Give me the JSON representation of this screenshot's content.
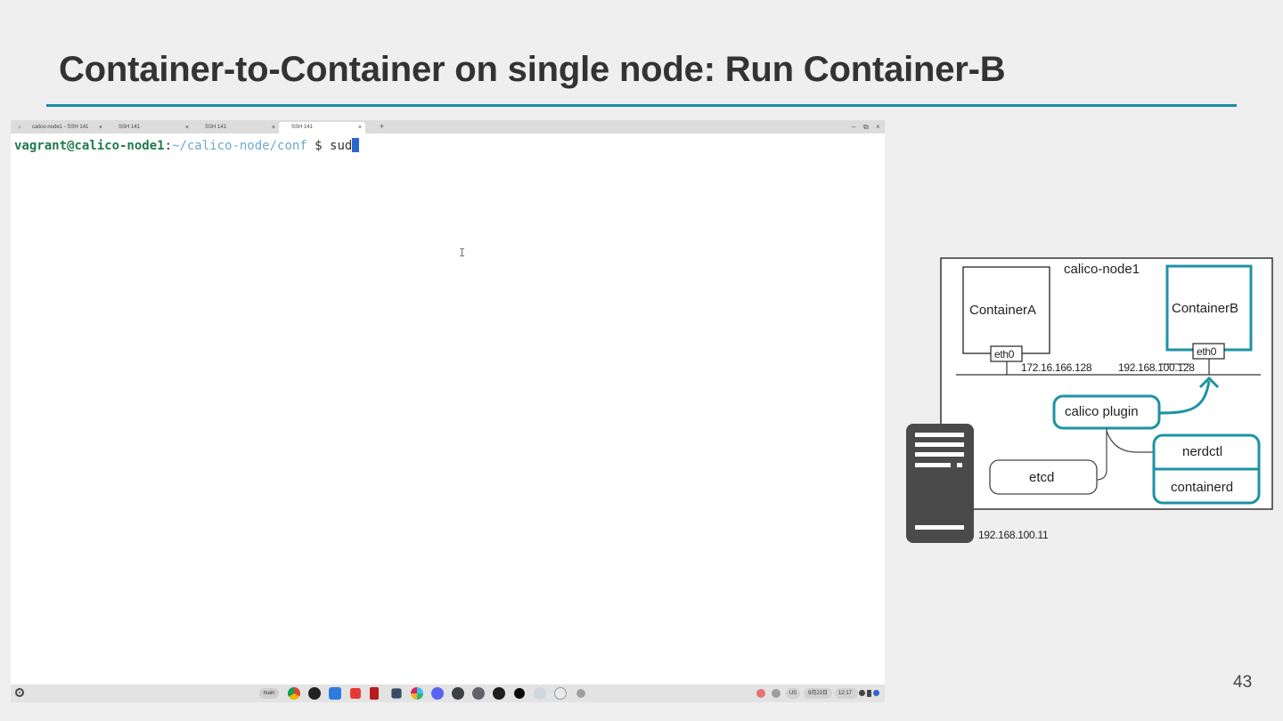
{
  "slide": {
    "title": "Container-to-Container on single node: Run Container-B",
    "page_number": "43",
    "accent_color": "#1c8ca6"
  },
  "terminal": {
    "tabs": [
      {
        "label": "calico-node1 - SSH 141",
        "active": false
      },
      {
        "label": "SSH 141",
        "active": false
      },
      {
        "label": "SSH 141",
        "active": false
      },
      {
        "label": "SSH 141",
        "active": true
      }
    ],
    "tab_close_glyph": "×",
    "new_tab_glyph": "+",
    "prompt": {
      "user_host": "vagrant@calico-node1",
      "separator": ":",
      "path": "~/calico-node/conf",
      "symbol": " $ ",
      "input": "sud"
    },
    "colors": {
      "user_host": "#1f7a50",
      "path": "#6fa8c8",
      "cursor": "#2a66d0"
    }
  },
  "shelf": {
    "desk_label": "main",
    "apps": [
      "chrome-icon",
      "gnome-icon",
      "files-icon",
      "youtube-icon",
      "netflix-icon",
      "bitwarden-icon",
      "slack-icon",
      "discord-icon",
      "terminal-icon",
      "dev-icon",
      "figma-icon",
      "app-icon",
      "vscode-icon",
      "assistant-icon",
      "settings-icon"
    ],
    "tray": {
      "locale": "US",
      "date": "9月23日",
      "time": "12:17"
    }
  },
  "diagram": {
    "node_name": "calico-node1",
    "container_a": "ContainerA",
    "container_b": "ContainerB",
    "eth_a": "eth0",
    "eth_b": "eth0",
    "ip_a": "172.16.166.128",
    "ip_b": "192.168.100.128",
    "plugin": "calico plugin",
    "etcd": "etcd",
    "nerdctl": "nerdctl",
    "containerd": "containerd",
    "host_ip": "192.168.100.11"
  }
}
